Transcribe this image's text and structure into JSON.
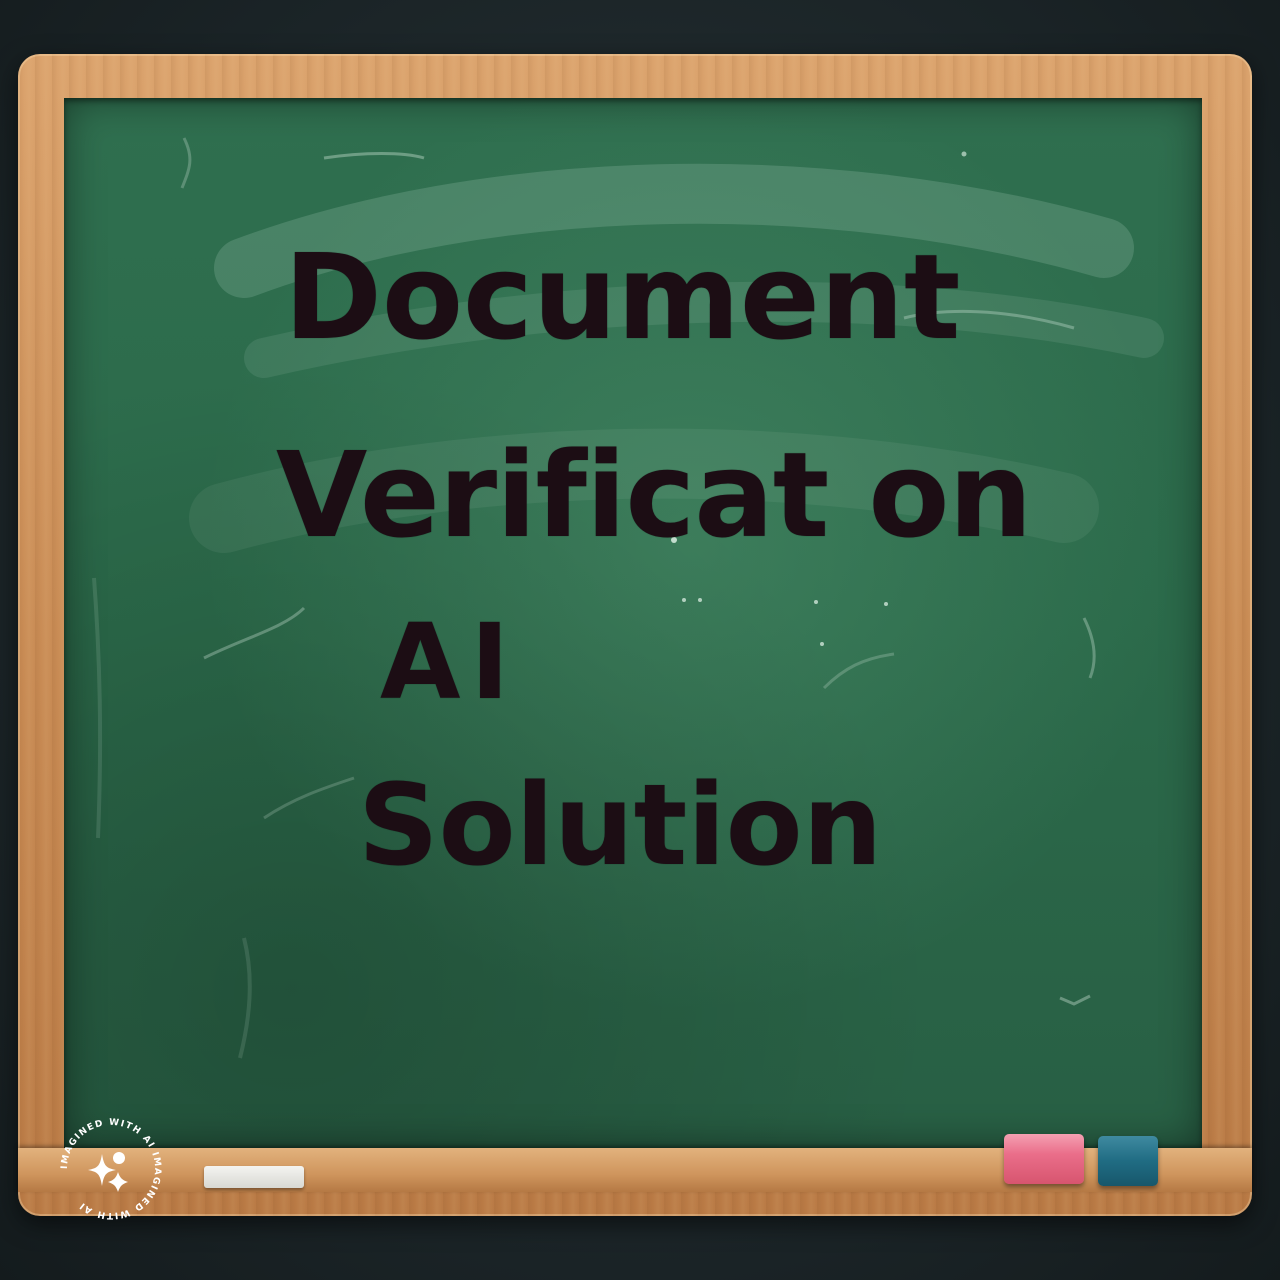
{
  "board": {
    "line1": "Document",
    "line2": "Verificat on",
    "line3": "AI",
    "line4": "Solution"
  },
  "watermark": {
    "text": "IMAGINED WITH AI IMAGINED WITH AI",
    "icon": "sparkle-icon"
  },
  "colors": {
    "chalkboard": "#2b6a4a",
    "frame_wood": "#c98c55",
    "text": "#1c0d14",
    "eraser_pink": "#ea6e8a",
    "eraser_teal": "#206c83",
    "background": "#1c2629"
  }
}
